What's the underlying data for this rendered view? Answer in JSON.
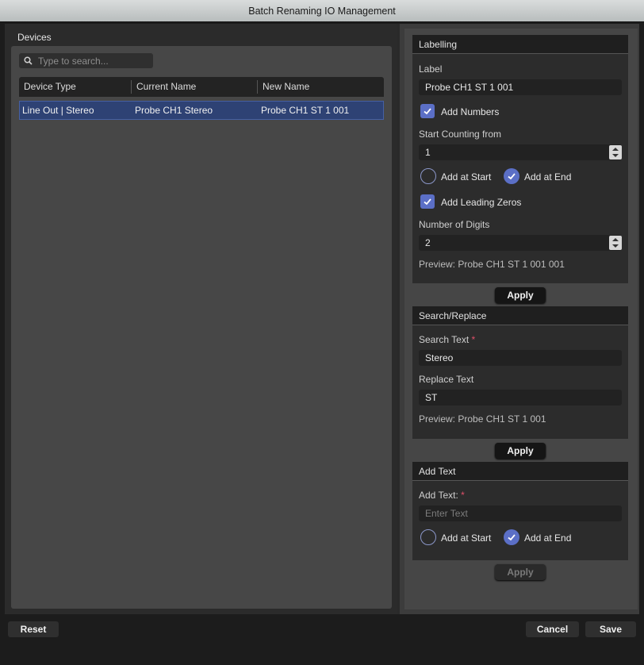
{
  "window": {
    "title": "Batch Renaming IO Management"
  },
  "devices": {
    "title": "Devices",
    "search_placeholder": "Type to search...",
    "columns": [
      "Device Type",
      "Current Name",
      "New Name"
    ],
    "rows": [
      {
        "device_type": "Line Out | Stereo",
        "current_name": "Probe CH1 Stereo",
        "new_name": "Probe CH1 ST 1 001"
      }
    ]
  },
  "labelling": {
    "title": "Labelling",
    "label_caption": "Label",
    "label_value": "Probe CH1 ST 1 001",
    "add_numbers": {
      "label": "Add Numbers",
      "checked": true
    },
    "start_caption": "Start Counting from",
    "start_value": "1",
    "add_at_start": {
      "label": "Add at Start",
      "selected": false
    },
    "add_at_end": {
      "label": "Add at End",
      "selected": true
    },
    "leading_zeros": {
      "label": "Add Leading Zeros",
      "checked": true
    },
    "digits_caption": "Number of Digits",
    "digits_value": "2",
    "preview": "Preview: Probe CH1 ST 1 001 001",
    "apply_label": "Apply"
  },
  "search_replace": {
    "title": "Search/Replace",
    "search_caption": "Search Text",
    "search_value": "Stereo",
    "replace_caption": "Replace Text",
    "replace_value": "ST",
    "preview": "Preview: Probe CH1 ST 1 001",
    "apply_label": "Apply",
    "required_mark": "*"
  },
  "add_text": {
    "title": "Add Text",
    "caption": "Add Text:",
    "placeholder": "Enter Text",
    "add_at_start": {
      "label": "Add at Start",
      "selected": false
    },
    "add_at_end": {
      "label": "Add at End",
      "selected": true
    },
    "apply_label": "Apply",
    "required_mark": "*"
  },
  "footer": {
    "reset": "Reset",
    "cancel": "Cancel",
    "save": "Save"
  },
  "colors": {
    "accent": "#5b6fc6",
    "selected_row": "#2e4274",
    "required": "#e0506a"
  }
}
